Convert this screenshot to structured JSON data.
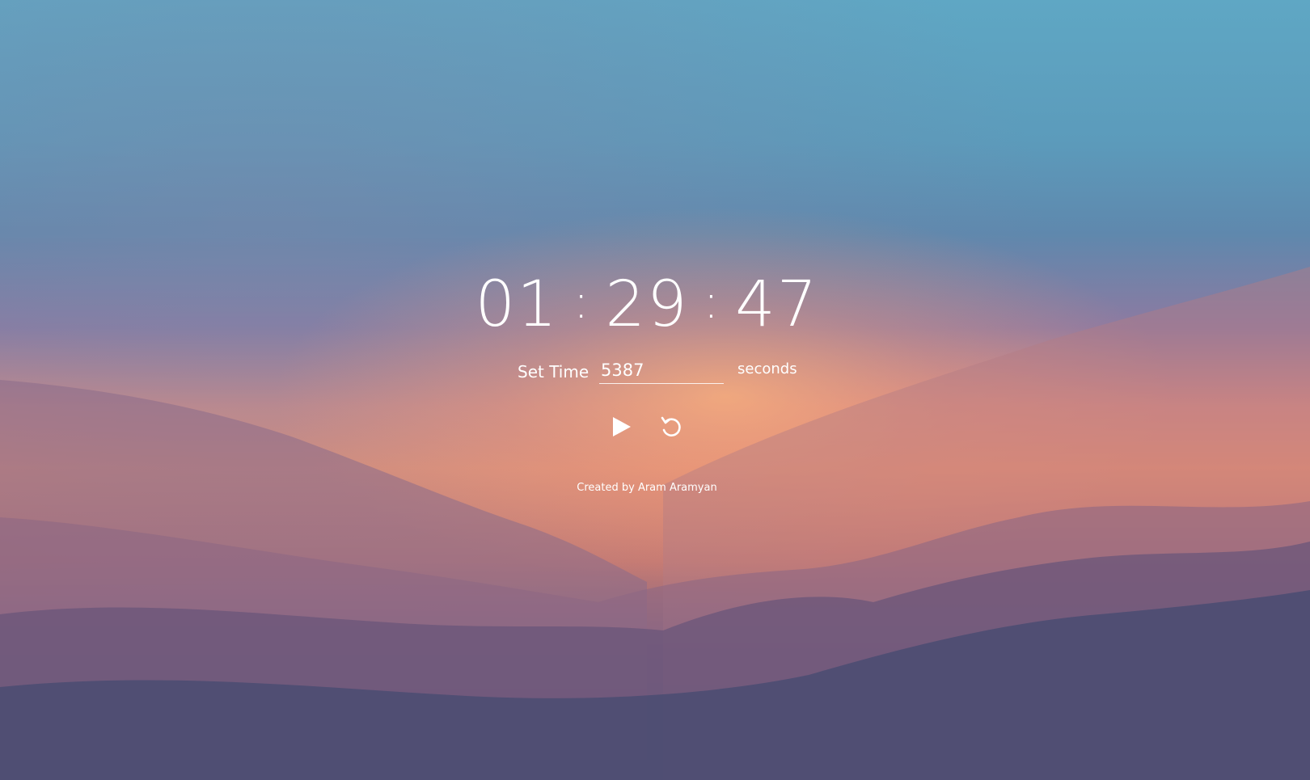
{
  "timer": {
    "hours": "01",
    "minutes": "29",
    "seconds": "47",
    "separator": ":"
  },
  "set_time": {
    "label": "Set Time",
    "input_value": "5387",
    "unit_label": "seconds"
  },
  "controls": {
    "play_icon": "play-icon",
    "reset_icon": "reset-icon"
  },
  "footer": {
    "credit": "Created by Aram Aramyan"
  },
  "background": {
    "description_colors": [
      "#5fa7c4",
      "#ee9070",
      "#47527a"
    ]
  }
}
